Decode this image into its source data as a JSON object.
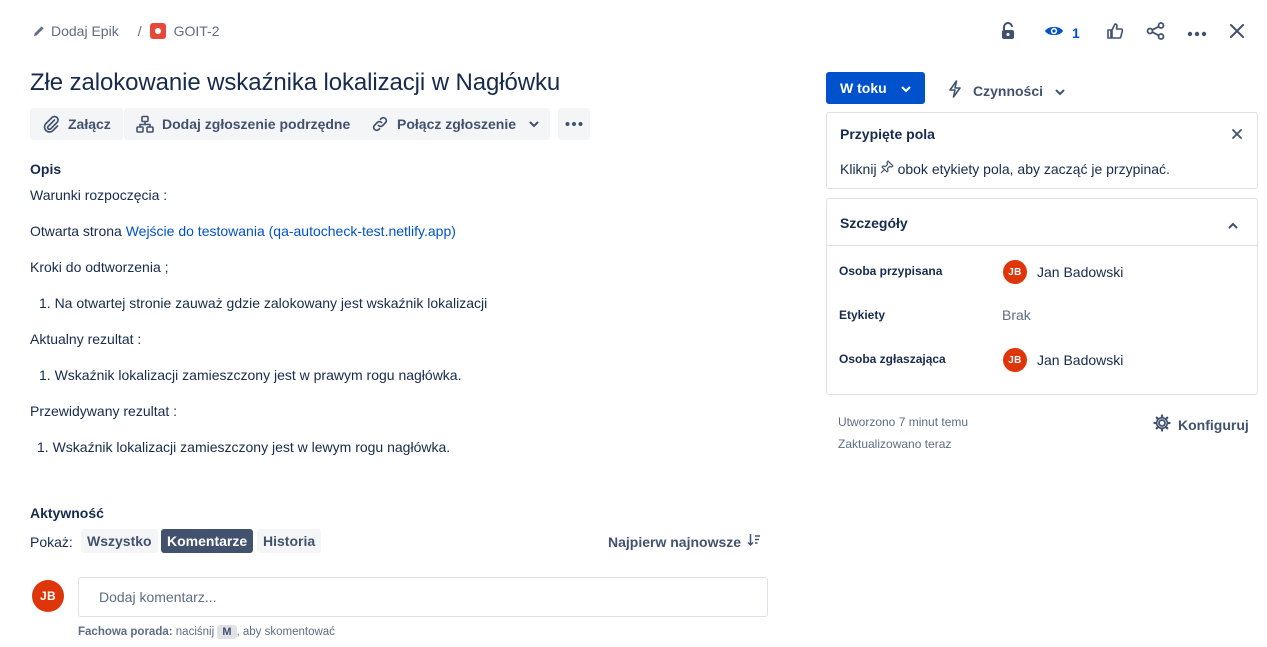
{
  "breadcrumb": {
    "add_epic": "Dodaj Epik",
    "separator": "/",
    "issue_key": "GOIT-2"
  },
  "top_actions": {
    "watchers_count": "1"
  },
  "issue": {
    "title": "Złe zalokowanie wskaźnika lokalizacji w Nagłówku"
  },
  "toolbar": {
    "attach": "Załącz",
    "add_child": "Dodaj zgłoszenie podrzędne",
    "link_issue": "Połącz zgłoszenie"
  },
  "description": {
    "heading": "Opis",
    "preconditions": "Warunki rozpoczęcia :",
    "page_opened_prefix": "Otwarta strona ",
    "page_link": "Wejście do testowania (qa-autocheck-test.netlify.app)",
    "steps_heading": "Kroki do odtworzenia  ;",
    "step_1": "1. Na otwartej stronie zauważ gdzie zalokowany jest wskaźnik lokalizacji",
    "actual_heading": "Aktualny rezultat :",
    "actual_1": "1. Wskaźnik lokalizacji zamieszczony jest w prawym rogu nagłówka.",
    "expected_heading": "Przewidywany rezultat :",
    "expected_1": "1. Wskaźnik lokalizacji zamieszczony jest w lewym rogu nagłówka."
  },
  "activity": {
    "heading": "Aktywność",
    "show_label": "Pokaż:",
    "filters": [
      "Wszystko",
      "Komentarze",
      "Historia"
    ],
    "active_filter": "Komentarze",
    "sort": "Najpierw najnowsze",
    "comment_placeholder": "Dodaj komentarz...",
    "tip_bold": "Fachowa porada:",
    "tip_press": " naciśnij ",
    "tip_key": "M",
    "tip_rest": ", aby skomentować"
  },
  "status": {
    "label": "W toku",
    "actions": "Czynności"
  },
  "pinned": {
    "heading": "Przypięte pola",
    "hint_before": "Kliknij ",
    "hint_after": " obok etykiety pola, aby zacząć je przypinać."
  },
  "details": {
    "heading": "Szczegóły",
    "assignee_label": "Osoba przypisana",
    "assignee": "Jan Badowski",
    "labels_label": "Etykiety",
    "labels_value": "Brak",
    "reporter_label": "Osoba zgłaszająca",
    "reporter": "Jan Badowski",
    "initials": "JB"
  },
  "meta": {
    "created": "Utworzono 7 minut temu",
    "updated": "Zaktualizowano teraz",
    "configure": "Konfiguruj"
  },
  "colors": {
    "primary": "#0052cc",
    "avatar": "#de350b",
    "issue_icon": "#e5493a"
  }
}
